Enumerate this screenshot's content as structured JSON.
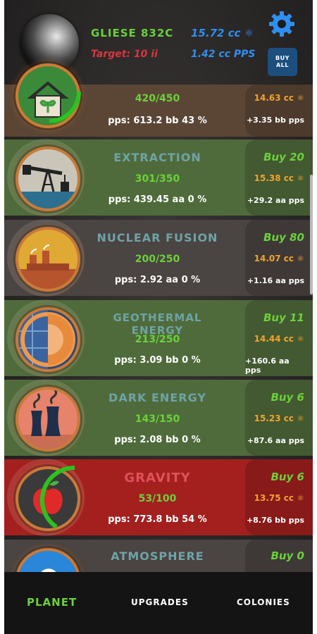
{
  "header": {
    "planet_name": "GLIESE 832C",
    "target": "Target: 10 ii",
    "cc_total": "15.72 cc",
    "pps_total": "1.42 cc PPS",
    "buy_all_line1": "BUY",
    "buy_all_line2": "ALL"
  },
  "rows": [
    {
      "title": "",
      "progress": "420/450",
      "pps": "pps: 613.2 bb   43 %",
      "buy": "",
      "cost": "14.63 cc",
      "gain": "+3.35 bb pps",
      "icon": "agriculture-icon"
    },
    {
      "title": "EXTRACTION",
      "progress": "301/350",
      "pps": "pps: 439.45 aa   0 %",
      "buy": "Buy 20",
      "cost": "15.38 cc",
      "gain": "+29.2 aa pps",
      "icon": "oil-pump-icon"
    },
    {
      "title": "NUCLEAR FUSION",
      "progress": "200/250",
      "pps": "pps: 2.92 aa   0 %",
      "buy": "Buy 80",
      "cost": "14.07 cc",
      "gain": "+1.16 aa pps",
      "icon": "nuclear-plant-icon"
    },
    {
      "title": "GEOTHERMAL ENERGY",
      "progress": "213/250",
      "pps": "pps: 3.09 bb   0 %",
      "buy": "Buy 11",
      "cost": "14.44 cc",
      "gain": "+160.6 aa pps",
      "icon": "earth-core-icon"
    },
    {
      "title": "DARK ENERGY",
      "progress": "143/150",
      "pps": "pps: 2.08 bb   0 %",
      "buy": "Buy 6",
      "cost": "15.23 cc",
      "gain": "+87.6 aa pps",
      "icon": "cooling-tower-icon"
    },
    {
      "title": "GRAVITY",
      "progress": "53/100",
      "pps": "pps: 773.8 bb   54 %",
      "buy": "Buy 6",
      "cost": "13.75 cc",
      "gain": "+8.76 bb pps",
      "icon": "apple-icon"
    },
    {
      "title": "ATMOSPHERE",
      "progress": "",
      "pps": "",
      "buy": "Buy 0",
      "cost": "",
      "gain": "",
      "icon": "cloud-icon"
    }
  ],
  "nav": {
    "planet": "PLANET",
    "upgrades": "UPGRADES",
    "colonies": "COLONIES"
  },
  "colors": {
    "accent_green": "#6bd13a",
    "accent_blue": "#2f8ff0",
    "target_red": "#d9363f",
    "cost_orange": "#f2a32b"
  }
}
